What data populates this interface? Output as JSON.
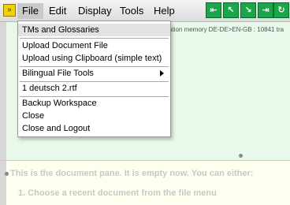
{
  "menubar": {
    "items": [
      {
        "label": "File"
      },
      {
        "label": "Edit"
      },
      {
        "label": "Display"
      },
      {
        "label": "Tools"
      },
      {
        "label": "Help"
      }
    ],
    "app_button_icon": "omegat-logo-icon",
    "toolbar_icons": [
      "nav-first-icon",
      "nav-prev-icon",
      "nav-next-icon",
      "nav-last-icon",
      "nav-jump-icon"
    ]
  },
  "file_menu": {
    "items": [
      {
        "label": "TMs and Glossaries"
      },
      {
        "label": "Upload Document File"
      },
      {
        "label": "Upload using Clipboard (simple text)"
      },
      {
        "label": "Bilingual File Tools"
      },
      {
        "label": "1 deutsch 2.rtf"
      },
      {
        "label": "Backup Workspace"
      },
      {
        "label": "Close"
      },
      {
        "label": "Close and Logout"
      }
    ]
  },
  "tm_pane": {
    "status_text": "ation memory DE-DE>EN-GB : 10841 tra"
  },
  "doc_pane": {
    "message": "This is the document pane. It is empty now. You can either:",
    "step1": "1.    Choose a recent document from the file menu"
  },
  "colors": {
    "tm_pane_bg": "#e8f8ea",
    "doc_pane_bg": "#fffff0",
    "toolbar_green": "#1aa64a",
    "app_yellow": "#f2d200"
  }
}
